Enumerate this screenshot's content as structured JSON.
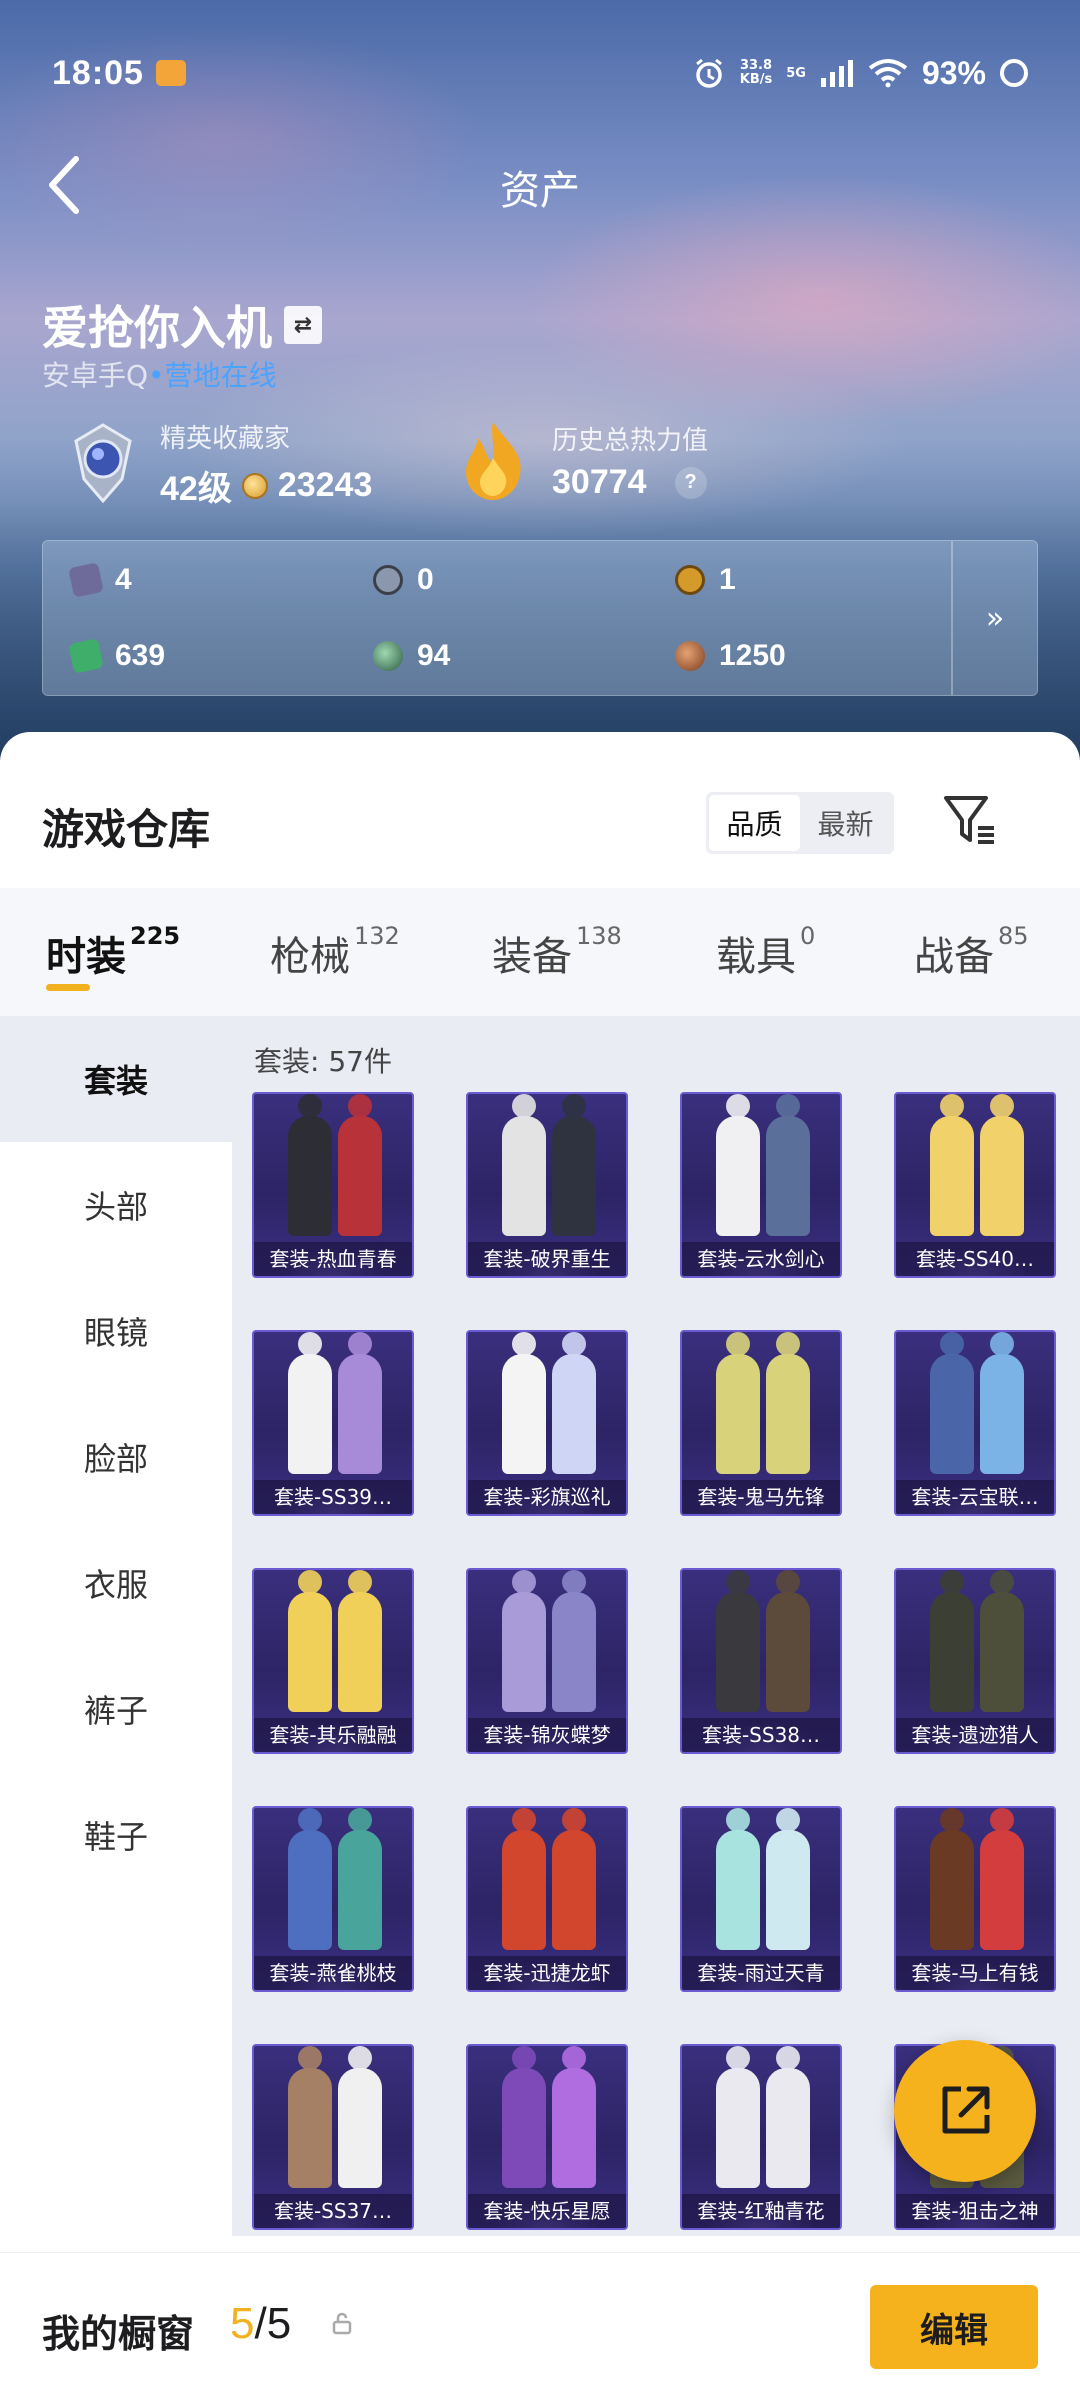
{
  "status_bar": {
    "time": "18:05",
    "net_speed_value": "33.8",
    "net_speed_unit": "KB/s",
    "network": "5G",
    "battery": "93%"
  },
  "header": {
    "title": "资产"
  },
  "profile": {
    "name": "爱抢你入机",
    "platform": "安卓手Q",
    "separator": "•",
    "online_status": "营地在线",
    "collector_title": "精英收藏家",
    "level": "42级",
    "coins": "23243",
    "heat_label": "历史总热力值",
    "heat_value": "30774",
    "help": "?"
  },
  "resources": [
    {
      "value": "4",
      "icon": "ticket-icon",
      "color": "#6e6a9a"
    },
    {
      "value": "0",
      "icon": "s-coin-icon",
      "color": "#8a97ad"
    },
    {
      "value": "1",
      "icon": "gold-token-icon",
      "color": "#d49a2a"
    },
    {
      "value": "639",
      "icon": "green-card-icon",
      "color": "#3fae6a"
    },
    {
      "value": "94",
      "icon": "green-orb-icon",
      "color": "#4f7d62"
    },
    {
      "value": "1250",
      "icon": "bronze-coin-icon",
      "color": "#b36a3a"
    }
  ],
  "resources_more": "»",
  "warehouse": {
    "title": "游戏仓库",
    "sort_options": [
      "品质",
      "最新"
    ]
  },
  "tabs": [
    {
      "label": "时装",
      "count": "225"
    },
    {
      "label": "枪械",
      "count": "132"
    },
    {
      "label": "装备",
      "count": "138"
    },
    {
      "label": "载具",
      "count": "0"
    },
    {
      "label": "战备",
      "count": "85"
    }
  ],
  "categories": [
    "套装",
    "头部",
    "眼镜",
    "脸部",
    "衣服",
    "裤子",
    "鞋子"
  ],
  "item_count_label": "套装: 57件",
  "items": [
    {
      "label": "套装-热血青春",
      "colors": [
        "#2d2d35",
        "#b8323a"
      ]
    },
    {
      "label": "套装-破界重生",
      "colors": [
        "#e3e3e3",
        "#2f3340"
      ]
    },
    {
      "label": "套装-云水剑心",
      "colors": [
        "#f0f0f2",
        "#5a6f9a"
      ]
    },
    {
      "label": "套装-SS40…",
      "colors": [
        "#f1d26a",
        "#f1d26a"
      ]
    },
    {
      "label": "套装-SS39…",
      "colors": [
        "#f2f2f2",
        "#a88bd8"
      ]
    },
    {
      "label": "套装-彩旗巡礼",
      "colors": [
        "#f4f4f4",
        "#cfd6f5"
      ]
    },
    {
      "label": "套装-鬼马先锋",
      "colors": [
        "#d8d37a",
        "#d8d37a"
      ]
    },
    {
      "label": "套装-云宝联…",
      "colors": [
        "#4a66a8",
        "#7bb3e6"
      ]
    },
    {
      "label": "套装-其乐融融",
      "colors": [
        "#f1d05a",
        "#f1d05a"
      ]
    },
    {
      "label": "套装-锦灰蝶梦",
      "colors": [
        "#a99bd8",
        "#8a85c8"
      ]
    },
    {
      "label": "套装-SS38…",
      "colors": [
        "#3a3a3e",
        "#5c4a3a"
      ]
    },
    {
      "label": "套装-遗迹猎人",
      "colors": [
        "#3c3f33",
        "#4d4f3a"
      ]
    },
    {
      "label": "套装-燕雀桃枝",
      "colors": [
        "#4e6fc0",
        "#49a59b"
      ]
    },
    {
      "label": "套装-迅捷龙虾",
      "colors": [
        "#d2462e",
        "#d2462e"
      ]
    },
    {
      "label": "套装-雨过天青",
      "colors": [
        "#a8e3e0",
        "#cfe9f0"
      ]
    },
    {
      "label": "套装-马上有钱",
      "colors": [
        "#6b3a24",
        "#d43d3d"
      ]
    },
    {
      "label": "套装-SS37…",
      "colors": [
        "#a58065",
        "#f0f0f0"
      ]
    },
    {
      "label": "套装-快乐星愿",
      "colors": [
        "#7d4ab8",
        "#b06de0"
      ]
    },
    {
      "label": "套装-红釉青花",
      "colors": [
        "#e9e9ef",
        "#e9e9ef"
      ]
    },
    {
      "label": "套装-狙击之神",
      "colors": [
        "#5a5a40",
        "#5a5a40"
      ]
    }
  ],
  "showcase": {
    "title": "我的橱窗",
    "current": "5",
    "total": "/5",
    "edit_label": "编辑"
  }
}
